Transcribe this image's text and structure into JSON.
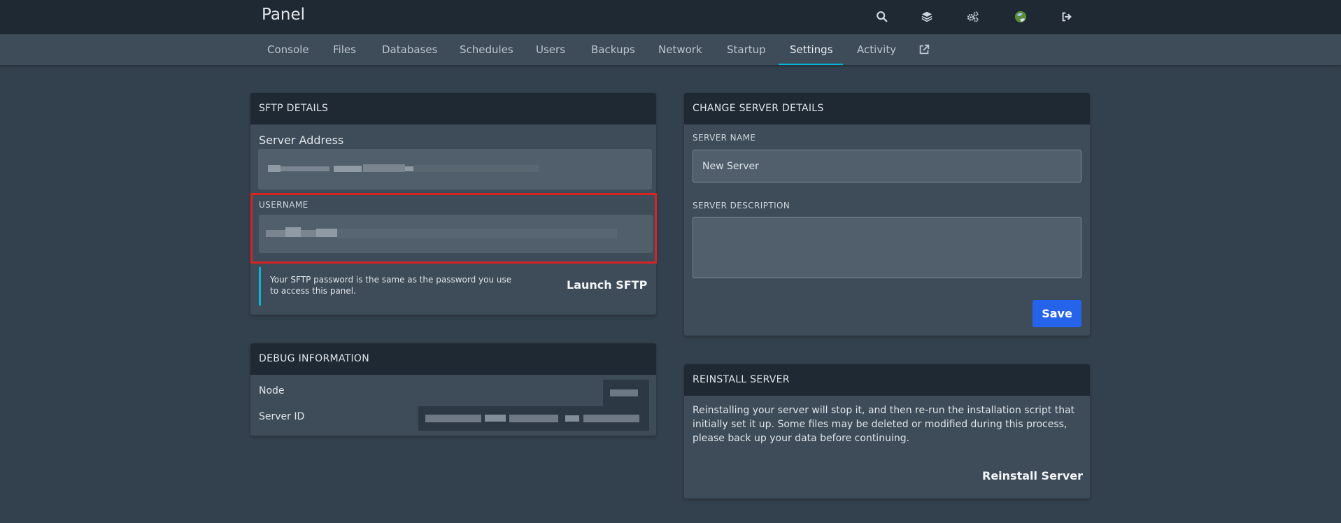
{
  "header": {
    "brand": "Panel",
    "icons": [
      "search-icon",
      "layers-icon",
      "cogs-icon",
      "avatar-icon",
      "logout-icon"
    ]
  },
  "nav": {
    "tabs": [
      {
        "label": "Console"
      },
      {
        "label": "Files"
      },
      {
        "label": "Databases"
      },
      {
        "label": "Schedules"
      },
      {
        "label": "Users"
      },
      {
        "label": "Backups"
      },
      {
        "label": "Network"
      },
      {
        "label": "Startup"
      },
      {
        "label": "Settings",
        "active": true
      },
      {
        "label": "Activity"
      }
    ],
    "external_icon": "external-link-icon"
  },
  "sftp": {
    "title": "SFTP DETAILS",
    "server_address_label": "Server Address",
    "username_label": "USERNAME",
    "info_text": "Your SFTP password is the same as the password you use to access this panel.",
    "launch_label": "Launch SFTP"
  },
  "debug": {
    "title": "DEBUG INFORMATION",
    "node_label": "Node",
    "server_id_label": "Server ID"
  },
  "change_details": {
    "title": "CHANGE SERVER DETAILS",
    "name_label": "SERVER NAME",
    "name_value": "New Server",
    "description_label": "SERVER DESCRIPTION",
    "description_value": "",
    "save_label": "Save"
  },
  "reinstall": {
    "title": "REINSTALL SERVER",
    "text": "Reinstalling your server will stop it, and then re-run the installation script that initially set it up. Some files may be deleted or modified during this process, please back up your data before continuing.",
    "button_label": "Reinstall Server"
  },
  "colors": {
    "accent": "#06b6d4",
    "primary": "#2563eb",
    "highlight": "#d42424"
  }
}
